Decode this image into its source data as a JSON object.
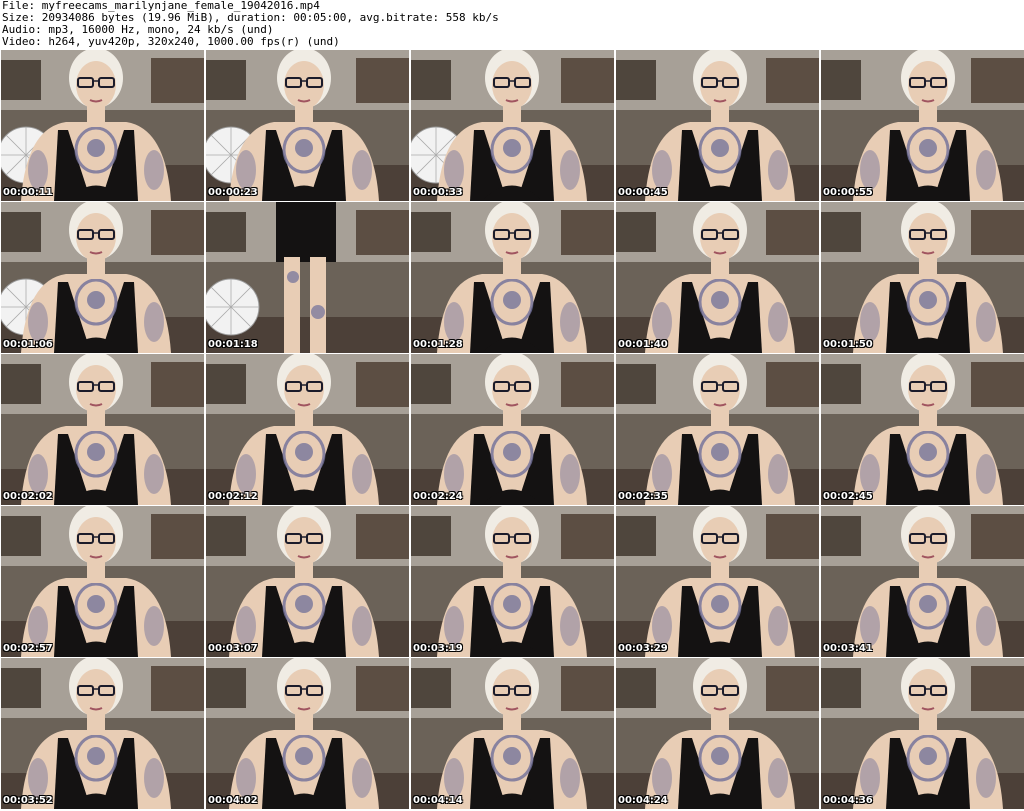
{
  "info": {
    "file": "File: myfreecams_marilynjane_female_19042016.mp4",
    "size": "Size: 20934086 bytes (19.96 MiB), duration: 00:05:00, avg.bitrate: 558 kb/s",
    "audio": "Audio: mp3, 16000 Hz, mono, 24 kb/s (und)",
    "video": "Video: h264, yuv420p, 320x240, 1000.00 fps(r) (und)"
  },
  "thumbnails": [
    {
      "time": "00:00:11",
      "wheel": true
    },
    {
      "time": "00:00:23",
      "wheel": true
    },
    {
      "time": "00:00:33",
      "wheel": true
    },
    {
      "time": "00:00:45",
      "wheel": false
    },
    {
      "time": "00:00:55",
      "wheel": false
    },
    {
      "time": "00:01:06",
      "wheel": true
    },
    {
      "time": "00:01:18",
      "wheel": true,
      "standing": true
    },
    {
      "time": "00:01:28",
      "wheel": false
    },
    {
      "time": "00:01:40",
      "wheel": false
    },
    {
      "time": "00:01:50",
      "wheel": false
    },
    {
      "time": "00:02:02",
      "wheel": false
    },
    {
      "time": "00:02:12",
      "wheel": false
    },
    {
      "time": "00:02:24",
      "wheel": false
    },
    {
      "time": "00:02:35",
      "wheel": false
    },
    {
      "time": "00:02:45",
      "wheel": false
    },
    {
      "time": "00:02:57",
      "wheel": false
    },
    {
      "time": "00:03:07",
      "wheel": false
    },
    {
      "time": "00:03:19",
      "wheel": false
    },
    {
      "time": "00:03:29",
      "wheel": false
    },
    {
      "time": "00:03:41",
      "wheel": false
    },
    {
      "time": "00:03:52",
      "wheel": false
    },
    {
      "time": "00:04:02",
      "wheel": false
    },
    {
      "time": "00:04:14",
      "wheel": false
    },
    {
      "time": "00:04:24",
      "wheel": false
    },
    {
      "time": "00:04:36",
      "wheel": false
    }
  ],
  "colors": {
    "background": "#ffffff",
    "room": "#6b6258",
    "wall": "#d9d4cc",
    "skin": "#e8cdb5",
    "hair": "#f0ece4",
    "top": "#141212",
    "tattoo": "#6f6f9a",
    "glasses": "#1b1b2a"
  }
}
